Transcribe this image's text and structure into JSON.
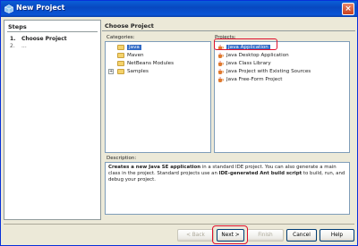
{
  "window": {
    "title": "New Project",
    "close_label": "×"
  },
  "steps": {
    "header": "Steps",
    "items": [
      {
        "num": "1.",
        "label": "Choose Project"
      },
      {
        "num": "2.",
        "label": "..."
      }
    ]
  },
  "main": {
    "header": "Choose Project",
    "categories_label": "Categories:",
    "projects_label": "Projects:",
    "description_label": "Description:",
    "categories": [
      {
        "label": "Java",
        "selected": true
      },
      {
        "label": "Maven",
        "selected": false
      },
      {
        "label": "NetBeans Modules",
        "selected": false
      },
      {
        "label": "Samples",
        "selected": false,
        "expander": "+"
      }
    ],
    "projects": [
      {
        "label": "Java Application",
        "selected": true
      },
      {
        "label": "Java Desktop Application",
        "selected": false
      },
      {
        "label": "Java Class Library",
        "selected": false
      },
      {
        "label": "Java Project with Existing Sources",
        "selected": false
      },
      {
        "label": "Java Free-Form Project",
        "selected": false
      }
    ],
    "description": {
      "part1_bold": "Creates a new Java SE application",
      "part2": " in a standard IDE project. You can also generate a main class in the project. Standard projects use an ",
      "part3_bold": "IDE-generated Ant build script",
      "part4": " to build, run, and debug your project."
    }
  },
  "buttons": {
    "back": "< Back",
    "next": "Next >",
    "finish": "Finish",
    "cancel": "Cancel",
    "help": "Help"
  },
  "colors": {
    "selection": "#316ac5",
    "highlight_ring": "#e0102c",
    "titlebar": "#0a5fd8"
  },
  "icons": {
    "window": "netbeans-cube-icon",
    "category": "folder-icon",
    "project": "java-cup-icon"
  }
}
